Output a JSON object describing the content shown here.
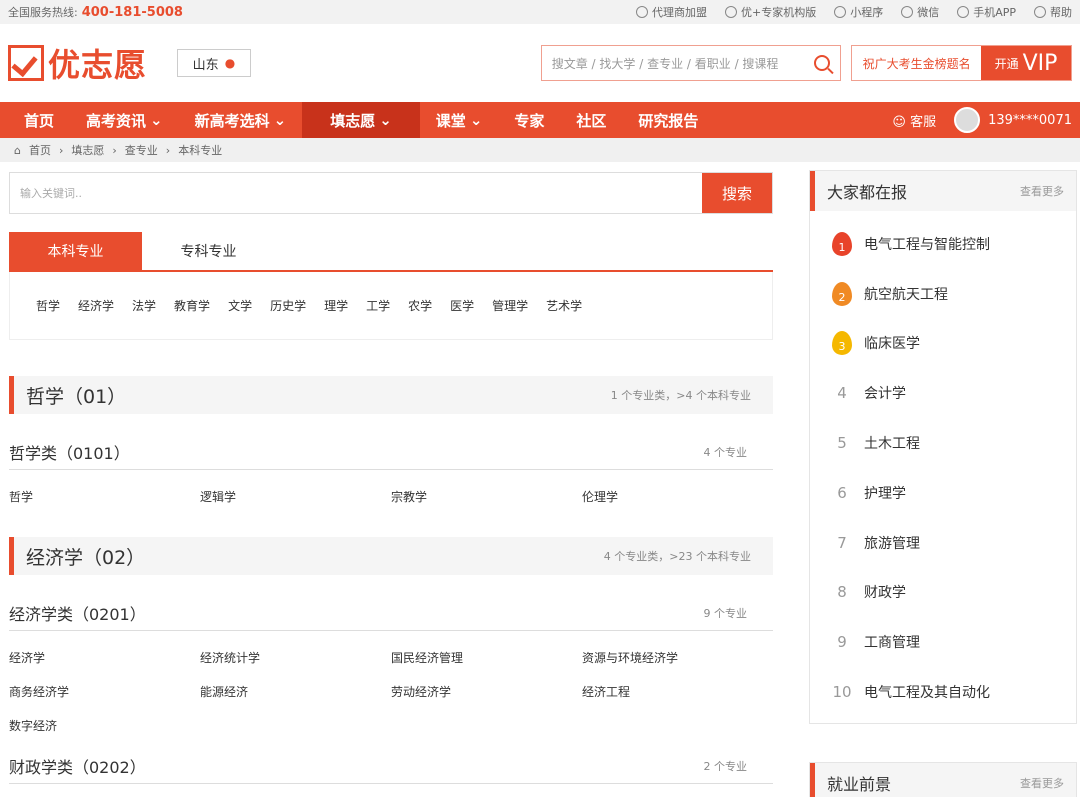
{
  "topbar": {
    "hotline_label": "全国服务热线:",
    "hotline": "400-181-5008",
    "links": [
      "代理商加盟",
      "优+专家机构版",
      "小程序",
      "微信",
      "手机APP",
      "帮助"
    ]
  },
  "header": {
    "logo": "优志愿",
    "location": "山东",
    "search_placeholder": "搜文章 / 找大学 / 查专业 / 看职业 / 搜课程",
    "vip_slogan": "祝广大考生金榜题名",
    "vip_btn": "开通",
    "vip_text": "VIP"
  },
  "nav": {
    "items": [
      "首页",
      "高考资讯",
      "新高考选科",
      "填志愿",
      "课堂",
      "专家",
      "社区",
      "研究报告"
    ],
    "service": "客服",
    "user": "139****0071"
  },
  "breadcrumb": [
    "首页",
    "填志愿",
    "查专业",
    "本科专业"
  ],
  "search": {
    "placeholder": "输入关键词..",
    "button": "搜索"
  },
  "tabs": [
    "本科专业",
    "专科专业"
  ],
  "categories": [
    "哲学",
    "经济学",
    "法学",
    "教育学",
    "文学",
    "历史学",
    "理学",
    "工学",
    "农学",
    "医学",
    "管理学",
    "艺术学"
  ],
  "sections": [
    {
      "title": "哲学（01）",
      "meta": "1 个专业类，>4 个本科专业",
      "subs": [
        {
          "title": "哲学类（0101）",
          "meta": "4 个专业",
          "majors": [
            "哲学",
            "逻辑学",
            "宗教学",
            "伦理学"
          ]
        }
      ]
    },
    {
      "title": "经济学（02）",
      "meta": "4 个专业类，>23 个本科专业",
      "subs": [
        {
          "title": "经济学类（0201）",
          "meta": "9 个专业",
          "majors": [
            "经济学",
            "经济统计学",
            "国民经济管理",
            "资源与环境经济学",
            "商务经济学",
            "能源经济",
            "劳动经济学",
            "经济工程",
            "数字经济"
          ]
        },
        {
          "title": "财政学类（0202）",
          "meta": "2 个专业"
        }
      ]
    }
  ],
  "popular": {
    "title": "大家都在报",
    "more": "查看更多",
    "items": [
      "电气工程与智能控制",
      "航空航天工程",
      "临床医学",
      "会计学",
      "土木工程",
      "护理学",
      "旅游管理",
      "财政学",
      "工商管理",
      "电气工程及其自动化"
    ],
    "ranks": [
      "1",
      "2",
      "3",
      "4",
      "5",
      "6",
      "7",
      "8",
      "9",
      "10"
    ],
    "medal_colors": [
      "#e8432a",
      "#f08a24",
      "#f5b800"
    ]
  },
  "career": {
    "title": "就业前景",
    "more": "查看更多"
  }
}
